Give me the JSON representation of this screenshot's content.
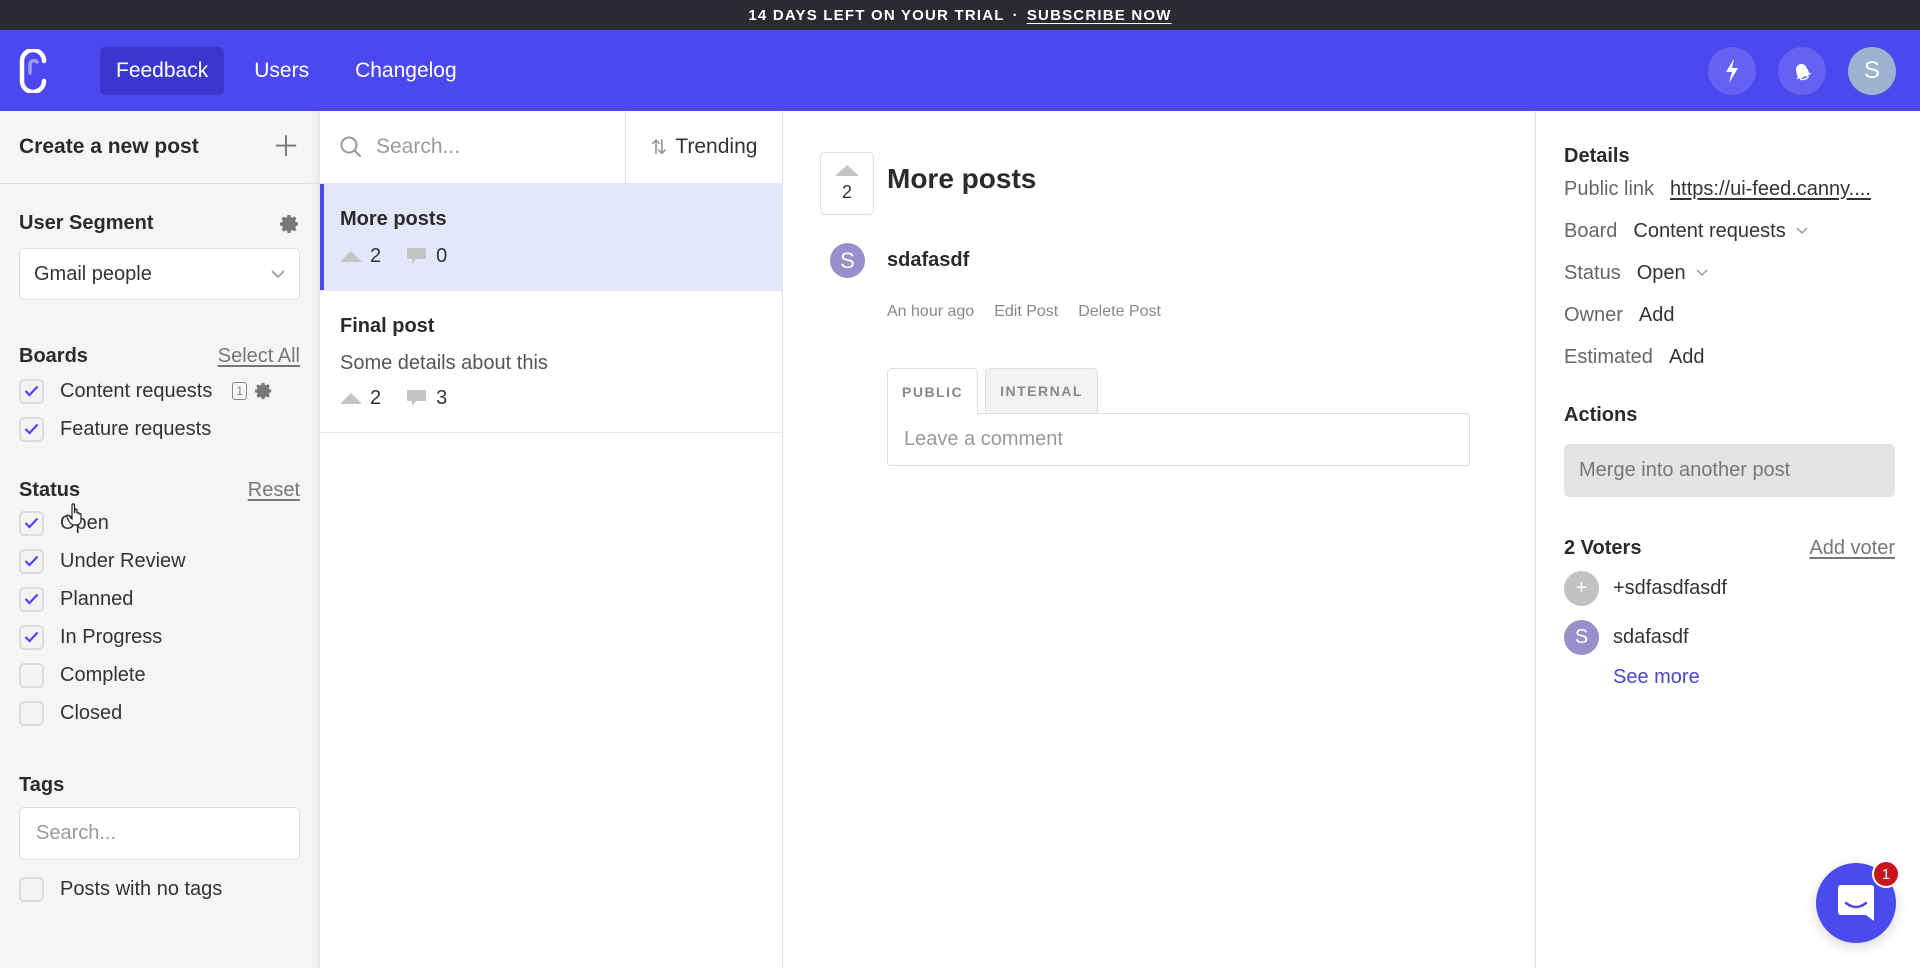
{
  "banner": {
    "text": "14 DAYS LEFT ON YOUR TRIAL",
    "separator": "·",
    "link": "SUBSCRIBE NOW"
  },
  "nav": {
    "tabs": [
      {
        "label": "Feedback",
        "active": true
      },
      {
        "label": "Users",
        "active": false
      },
      {
        "label": "Changelog",
        "active": false
      }
    ],
    "icons": [
      "bolt-icon",
      "bell-icon"
    ],
    "avatar_initial": "S",
    "brand_color": "#4a48ee"
  },
  "sidebar": {
    "create_label": "Create a new post",
    "segment": {
      "title": "User Segment",
      "selected": "Gmail people"
    },
    "boards": {
      "title": "Boards",
      "action": "Select All",
      "items": [
        {
          "label": "Content requests",
          "checked": true,
          "count": "1"
        },
        {
          "label": "Feature requests",
          "checked": true
        }
      ]
    },
    "status": {
      "title": "Status",
      "action": "Reset",
      "items": [
        {
          "label": "Open",
          "checked": true
        },
        {
          "label": "Under Review",
          "checked": true
        },
        {
          "label": "Planned",
          "checked": true
        },
        {
          "label": "In Progress",
          "checked": true
        },
        {
          "label": "Complete",
          "checked": false
        },
        {
          "label": "Closed",
          "checked": false
        }
      ]
    },
    "tags": {
      "title": "Tags",
      "search_placeholder": "Search...",
      "no_tags_label": "Posts with no tags",
      "no_tags_checked": false
    }
  },
  "postlist": {
    "search_placeholder": "Search...",
    "sort_label": "Trending",
    "posts": [
      {
        "title": "More posts",
        "description": "",
        "votes": "2",
        "comments": "0",
        "active": true
      },
      {
        "title": "Final post",
        "description": "Some details about this",
        "votes": "2",
        "comments": "3",
        "active": false
      }
    ]
  },
  "post": {
    "votes": "2",
    "title": "More posts",
    "author_initial": "S",
    "author": "sdafasdf",
    "time": "An hour ago",
    "edit_label": "Edit Post",
    "delete_label": "Delete Post",
    "comment_tabs": [
      "PUBLIC",
      "INTERNAL"
    ],
    "comment_placeholder": "Leave a comment"
  },
  "details": {
    "title": "Details",
    "rows": {
      "public_link": {
        "key": "Public link",
        "value": "https://ui-feed.canny...."
      },
      "board": {
        "key": "Board",
        "value": "Content requests"
      },
      "status": {
        "key": "Status",
        "value": "Open"
      },
      "owner": {
        "key": "Owner",
        "value": "Add"
      },
      "estimated": {
        "key": "Estimated",
        "value": "Add"
      }
    },
    "actions_title": "Actions",
    "merge_label": "Merge into another post",
    "voters_title": "2 Voters",
    "add_voter": "Add voter",
    "voters": [
      {
        "initial": "+",
        "name": "+sdfasdfasdf",
        "color": "#c2c2c2"
      },
      {
        "initial": "S",
        "name": "sdafasdf",
        "color": "#9b8fcb"
      }
    ],
    "see_more": "See more"
  },
  "chat": {
    "badge": "1"
  }
}
